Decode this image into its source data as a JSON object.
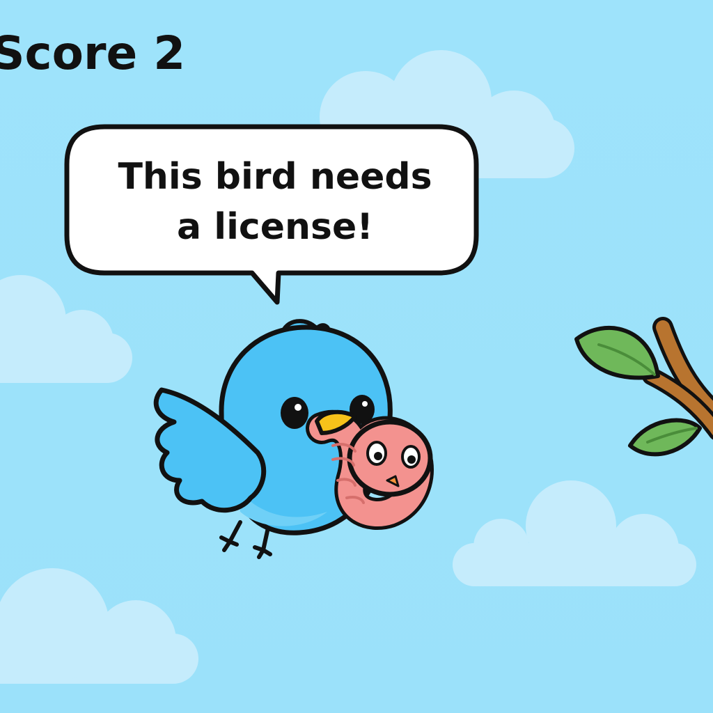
{
  "hud": {
    "score_label": "Score",
    "score_value": "2"
  },
  "speech": {
    "line1": "This bird needs",
    "line2": "a license!"
  },
  "colors": {
    "sky": "#9ee3fb",
    "cloud": "#c5ecfc",
    "bird_body": "#4cc2f5",
    "bird_belly": "#6fd0f7",
    "beak": "#f7c21a",
    "worm": "#f3928f",
    "leaf": "#6fb85a",
    "branch": "#b8742f",
    "outline": "#111111"
  },
  "icons": [
    "bird-icon",
    "worm-icon",
    "branch-icon",
    "cloud-icon"
  ]
}
